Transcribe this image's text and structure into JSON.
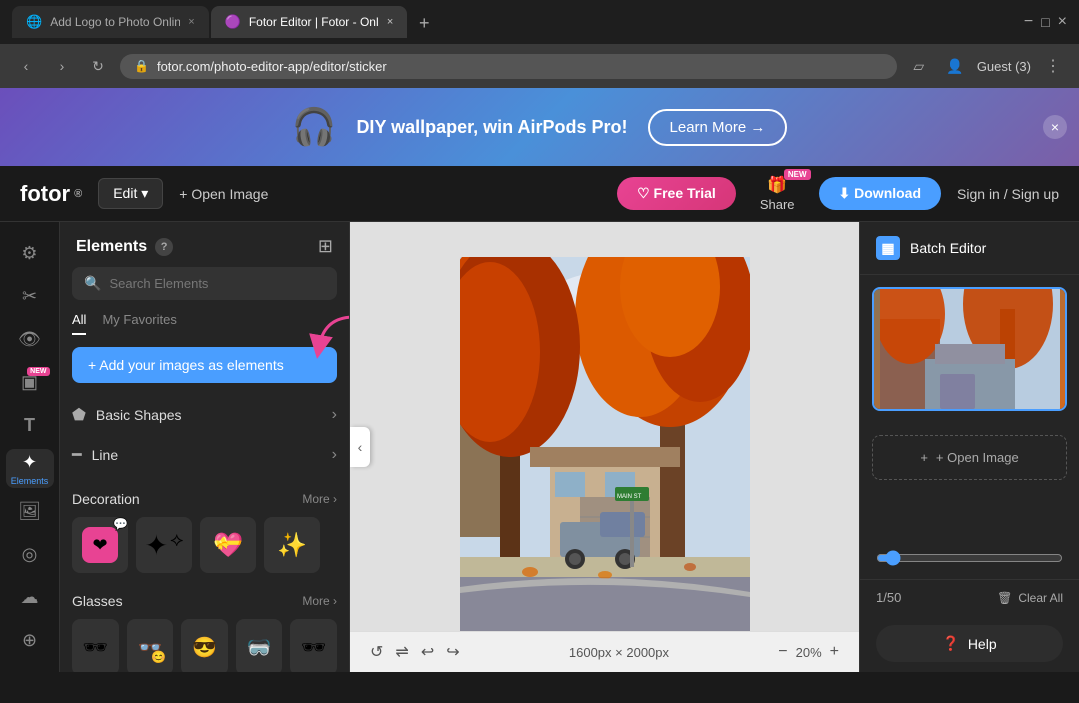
{
  "browser": {
    "tabs": [
      {
        "id": "tab1",
        "favicon": "🌐",
        "title": "Add Logo to Photo Online for...",
        "active": false
      },
      {
        "id": "tab2",
        "favicon": "🟣",
        "title": "Fotor Editor | Fotor - Online...",
        "active": true
      }
    ],
    "new_tab_label": "+",
    "controls": {
      "back": "‹",
      "forward": "›",
      "refresh": "↻"
    },
    "address": "fotor.com/photo-editor-app/editor/sticker",
    "lock_icon": "🔒",
    "window_controls": {
      "minimize": "−",
      "maximize": "□",
      "close": "×"
    },
    "guest_label": "Guest (3)",
    "menu_icon": "⋮"
  },
  "banner": {
    "icon": "🎧",
    "text": "DIY wallpaper, win AirPods Pro!",
    "learn_more": "Learn More →",
    "close": "×"
  },
  "header": {
    "logo": "fotor",
    "logo_sup": "®",
    "edit_btn": "Edit ▾",
    "open_image": "+ Open Image",
    "free_trial": "♡ Free Trial",
    "share": "Share",
    "share_new": "NEW",
    "download": "⬇ Download",
    "signin": "Sign in / Sign up"
  },
  "sidebar": {
    "icons": [
      {
        "id": "settings",
        "symbol": "⚙",
        "label": "",
        "active": false,
        "new": false
      },
      {
        "id": "crop",
        "symbol": "✂",
        "label": "",
        "active": false,
        "new": false
      },
      {
        "id": "eye",
        "symbol": "👁",
        "label": "",
        "active": false,
        "new": false
      },
      {
        "id": "layers",
        "symbol": "▣",
        "label": "",
        "active": false,
        "new": true
      },
      {
        "id": "text",
        "symbol": "T",
        "label": "",
        "active": false,
        "new": false
      },
      {
        "id": "elements",
        "symbol": "✦",
        "label": "Elements",
        "active": true,
        "new": false
      },
      {
        "id": "image",
        "symbol": "🖼",
        "label": "",
        "active": false,
        "new": false
      },
      {
        "id": "circle",
        "symbol": "◎",
        "label": "",
        "active": false,
        "new": false
      },
      {
        "id": "cloud",
        "symbol": "☁",
        "label": "",
        "active": false,
        "new": false
      },
      {
        "id": "more",
        "symbol": "⊕",
        "label": "",
        "active": false,
        "new": false
      }
    ]
  },
  "elements_panel": {
    "title": "Elements",
    "help_icon": "?",
    "grid_icon": "⊞",
    "search_placeholder": "Search Elements",
    "tabs": [
      {
        "id": "all",
        "label": "All",
        "active": true
      },
      {
        "id": "favorites",
        "label": "My Favorites",
        "active": false
      }
    ],
    "add_button": "+ Add your images as elements",
    "sections": [
      {
        "id": "basic-shapes",
        "icon": "⬟",
        "label": "Basic Shapes",
        "arrow": "›"
      },
      {
        "id": "line",
        "icon": "━",
        "label": "Line",
        "arrow": "›"
      }
    ],
    "decoration": {
      "title": "Decoration",
      "more": "More ›",
      "items": [
        "❤️💥",
        "✨💫",
        "💖💗",
        "✨🎆"
      ]
    },
    "glasses": {
      "title": "Glasses",
      "more": "More ›",
      "items": [
        "🕶",
        "👓",
        "🥽",
        "🕶",
        "🥽"
      ]
    }
  },
  "canvas": {
    "dimensions": "1600px × 2000px",
    "zoom": "20%",
    "controls": {
      "undo": "↺",
      "redo": "↻",
      "back": "‹",
      "forward": "›",
      "reset": "⟲",
      "copy": "❐",
      "zoom_out": "−",
      "zoom_in": "+"
    }
  },
  "right_panel": {
    "batch_editor_icon": "▦",
    "batch_editor_title": "Batch Editor",
    "open_image": "+ Open Image",
    "pagination": "1/50",
    "clear_all": "Clear All",
    "help": "Help"
  }
}
